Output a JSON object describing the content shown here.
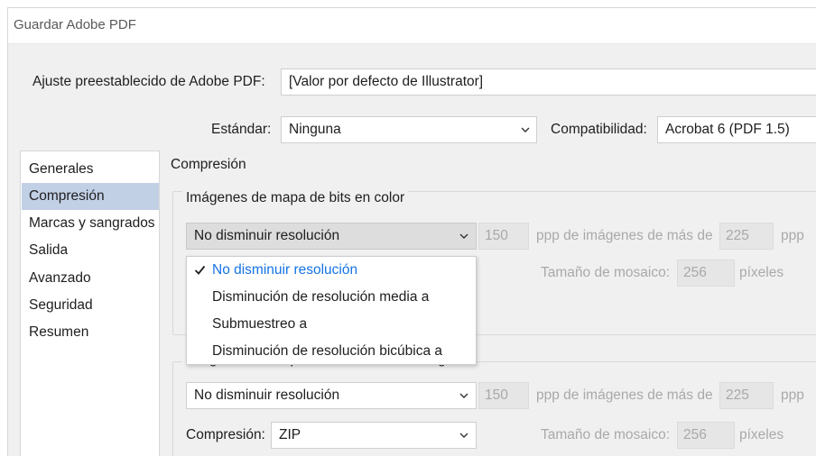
{
  "window": {
    "title": "Guardar Adobe PDF"
  },
  "preset": {
    "label": "Ajuste preestablecido de Adobe PDF:",
    "value": "[Valor por defecto de Illustrator]"
  },
  "standard": {
    "label": "Estándar:",
    "value": "Ninguna"
  },
  "compatibility": {
    "label": "Compatibilidad:",
    "value": "Acrobat 6 (PDF 1.5)"
  },
  "sidebar": {
    "items": [
      {
        "label": "Generales"
      },
      {
        "label": "Compresión",
        "selected": true
      },
      {
        "label": "Marcas y sangrados"
      },
      {
        "label": "Salida"
      },
      {
        "label": "Avanzado"
      },
      {
        "label": "Seguridad"
      },
      {
        "label": "Resumen"
      }
    ]
  },
  "main": {
    "section_title": "Compresión",
    "color_group": {
      "legend": "Imágenes de mapa de bits en color",
      "downsample_value": "No disminuir resolución",
      "ppi_value": "150",
      "ppi_label": "ppp de imágenes de más de",
      "above_value": "225",
      "ppp_unit": "ppp",
      "tile_label": "Tamaño de mosaico:",
      "tile_value": "256",
      "tile_unit": "píxeles"
    },
    "gray_group": {
      "legend": "Imágenes de mapa de bits en escala de gris",
      "downsample_value": "No disminuir resolución",
      "ppi_value": "150",
      "ppi_label": "ppp de imágenes de más de",
      "above_value": "225",
      "ppp_unit": "ppp",
      "compression_label": "Compresión:",
      "compression_value": "ZIP",
      "tile_label": "Tamaño de mosaico:",
      "tile_value": "256",
      "tile_unit": "píxeles"
    }
  },
  "dropdown": {
    "options": [
      {
        "label": "No disminuir resolución",
        "checked": true
      },
      {
        "label": "Disminución de resolución media a"
      },
      {
        "label": "Submuestreo a"
      },
      {
        "label": "Disminución de resolución bicúbica a"
      }
    ]
  },
  "colors": {
    "accent": "#1473e6",
    "selection": "#c2d0e6",
    "panel": "#f0f0f0"
  }
}
